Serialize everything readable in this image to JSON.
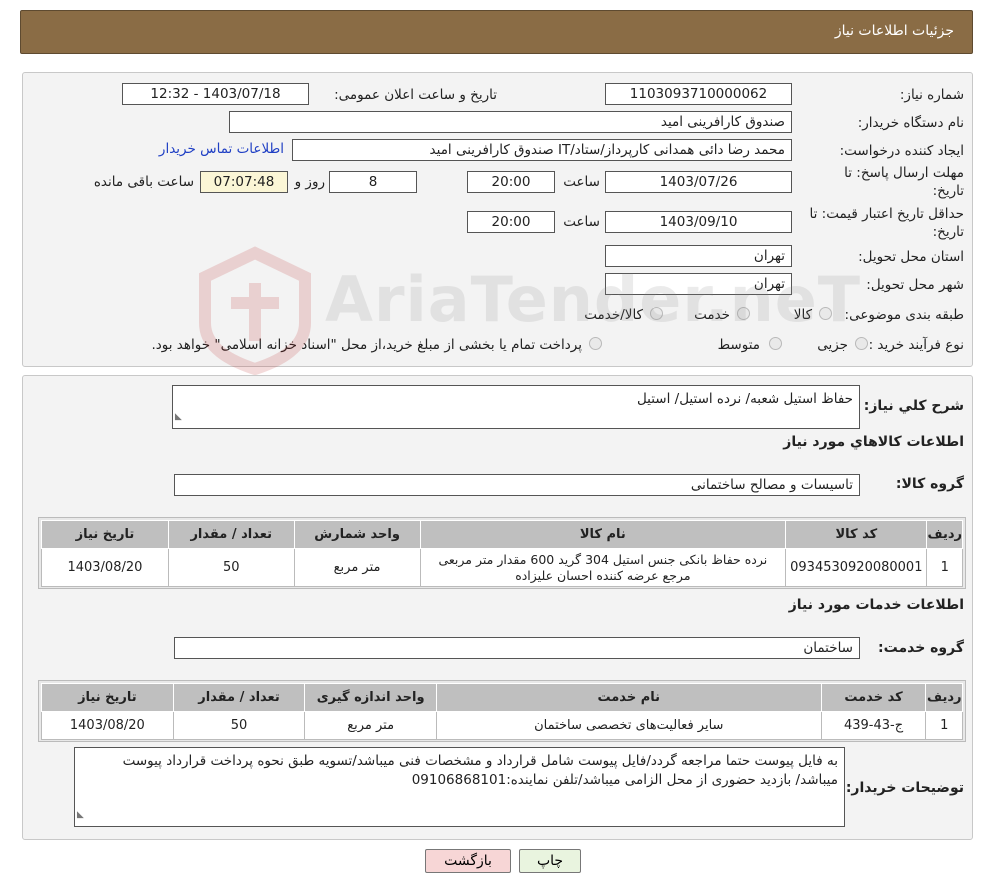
{
  "header": {
    "title": "جزئیات اطلاعات نیاز"
  },
  "info": {
    "need_number_label": "شماره نیاز:",
    "need_number": "1103093710000062",
    "announce_datetime_label": "تاریخ و ساعت اعلان عمومی:",
    "announce_datetime": "1403/07/18 - 12:32",
    "buyer_org_label": "نام دستگاه خریدار:",
    "buyer_org": "صندوق کارافرینی امید",
    "requester_label": "ایجاد کننده درخواست:",
    "requester": "محمد رضا دائی همدانی کارپرداز/ستاد/IT صندوق کارافرینی امید",
    "contact_link": "اطلاعات تماس خریدار",
    "reply_deadline_label_1": "مهلت ارسال پاسخ: تا",
    "reply_deadline_label_2": "تاریخ:",
    "reply_date": "1403/07/26",
    "time_label": "ساعت",
    "reply_time": "20:00",
    "days_value": "8",
    "days_label": "روز و",
    "remaining_time": "07:07:48",
    "remaining_label": "ساعت باقی مانده",
    "price_validity_label_1": "حداقل تاریخ اعتبار قیمت: تا",
    "price_validity_label_2": "تاریخ:",
    "price_validity_date": "1403/09/10",
    "price_validity_time": "20:00",
    "province_label": "استان محل تحویل:",
    "province": "تهران",
    "city_label": "شهر محل تحویل:",
    "city": "تهران",
    "category_label": "طبقه بندی موضوعی:",
    "category_options": [
      "کالا",
      "خدمت",
      "کالا/خدمت"
    ],
    "purchase_type_label": "نوع فرآیند خرید :",
    "purchase_type_options": [
      "جزیی",
      "متوسط"
    ],
    "purchase_note": "پرداخت تمام یا بخشی از مبلغ خرید،از محل \"اسناد خزانه اسلامی\" خواهد بود."
  },
  "items": {
    "summary_label": "شرح کلي نياز:",
    "summary": "حفاظ استیل شعبه/ نرده استیل/ استیل",
    "goods_section_title": "اطلاعات کالاهاي مورد نياز",
    "goods_group_label": "گروه کالا:",
    "goods_group": "تاسیسات و مصالح ساختمانی",
    "goods_columns": [
      "رديف",
      "کد کالا",
      "نام کالا",
      "واحد شمارش",
      "تعداد / مقدار",
      "تاريخ نياز"
    ],
    "goods_rows": [
      {
        "row": "1",
        "code": "0934530920080001",
        "name": "نرده حفاظ بانکی جنس استیل 304 گرید 600 مقدار متر مربعی مرجع عرضه کننده احسان علیزاده",
        "unit": "متر مربع",
        "qty": "50",
        "date": "1403/08/20"
      }
    ],
    "services_section_title": "اطلاعات خدمات مورد نياز",
    "service_group_label": "گروه خدمت:",
    "service_group": "ساختمان",
    "services_columns": [
      "رديف",
      "کد خدمت",
      "نام خدمت",
      "واحد اندازه گيری",
      "تعداد / مقدار",
      "تاريخ نياز"
    ],
    "services_rows": [
      {
        "row": "1",
        "code": "ج-43-439",
        "name": "سایر فعالیت‌های تخصصی ساختمان",
        "unit": "متر مربع",
        "qty": "50",
        "date": "1403/08/20"
      }
    ],
    "buyer_notes_label": "توضیحات خریدار:",
    "buyer_notes": "به فایل پیوست حتما مراجعه گردد/فایل پیوست شامل قرارداد و مشخصات فنی میباشد/تسویه طبق نحوه پرداخت قرارداد پیوست میباشد/ بازدید حضوری از محل الزامی میباشد/تلفن نماینده:09106868101"
  },
  "buttons": {
    "print": "چاپ",
    "back": "بازگشت"
  },
  "watermark": {
    "text": "AriaTender.neT"
  },
  "colors": {
    "header_bg": "#8a6c45",
    "panel_bg": "#f3f3f3",
    "link": "#1f3fc4",
    "back_button_bg": "#f7d6d6",
    "print_button_bg": "#e9f4df"
  }
}
